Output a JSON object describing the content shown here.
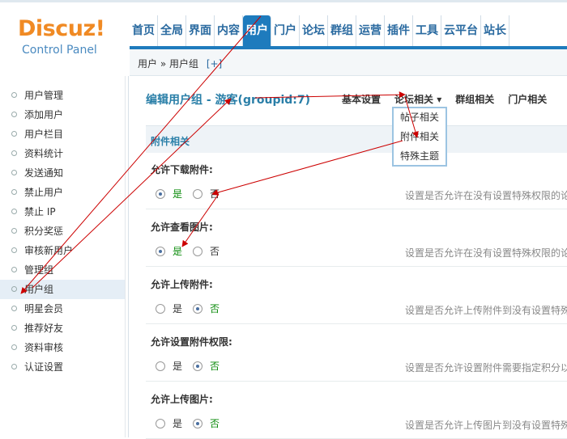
{
  "logo": {
    "brand": "Discuz!",
    "sub": "Control Panel"
  },
  "nav": [
    "首页",
    "全局",
    "界面",
    "内容",
    "用户",
    "门户",
    "论坛",
    "群组",
    "运营",
    "插件",
    "工具",
    "云平台",
    "站长"
  ],
  "nav_active": 4,
  "breadcrumb": {
    "path": "用户 » 用户组",
    "plus": "[+]"
  },
  "sidebar": [
    "用户管理",
    "添加用户",
    "用户栏目",
    "资料统计",
    "发送通知",
    "禁止用户",
    "禁止 IP",
    "积分奖惩",
    "审核新用户",
    "管理组",
    "用户组",
    "明星会员",
    "推荐好友",
    "资料审核",
    "认证设置"
  ],
  "sidebar_active": 10,
  "page_title": "编辑用户组 - 游客(groupid:7)",
  "tabs": [
    "基本设置",
    "论坛相关 ▾",
    "群组相关",
    "门户相关"
  ],
  "dropdown": [
    "帖子相关",
    "附件相关",
    "特殊主题"
  ],
  "section_title": "附件相关",
  "rows": [
    {
      "label": "允许下载附件:",
      "yes": "是",
      "no": "否",
      "selected": "yes",
      "desc": "设置是否允许在没有设置特殊权限的论"
    },
    {
      "label": "允许查看图片:",
      "yes": "是",
      "no": "否",
      "selected": "yes",
      "desc": "设置是否允许在没有设置特殊权限的论"
    },
    {
      "label": "允许上传附件:",
      "yes": "是",
      "no": "否",
      "selected": "no",
      "desc": "设置是否允许上传附件到没有设置特殊"
    },
    {
      "label": "允许设置附件权限:",
      "yes": "是",
      "no": "否",
      "selected": "no",
      "desc": "设置是否允许设置附件需要指定积分以"
    },
    {
      "label": "允许上传图片:",
      "yes": "是",
      "no": "否",
      "selected": "no",
      "desc": "设置是否允许上传图片到没有设置特殊"
    }
  ],
  "colors": {
    "accent": "#1e7bbd",
    "title": "#2a7fa8",
    "logo": "#f08a24",
    "arrow": "#cc0000"
  }
}
